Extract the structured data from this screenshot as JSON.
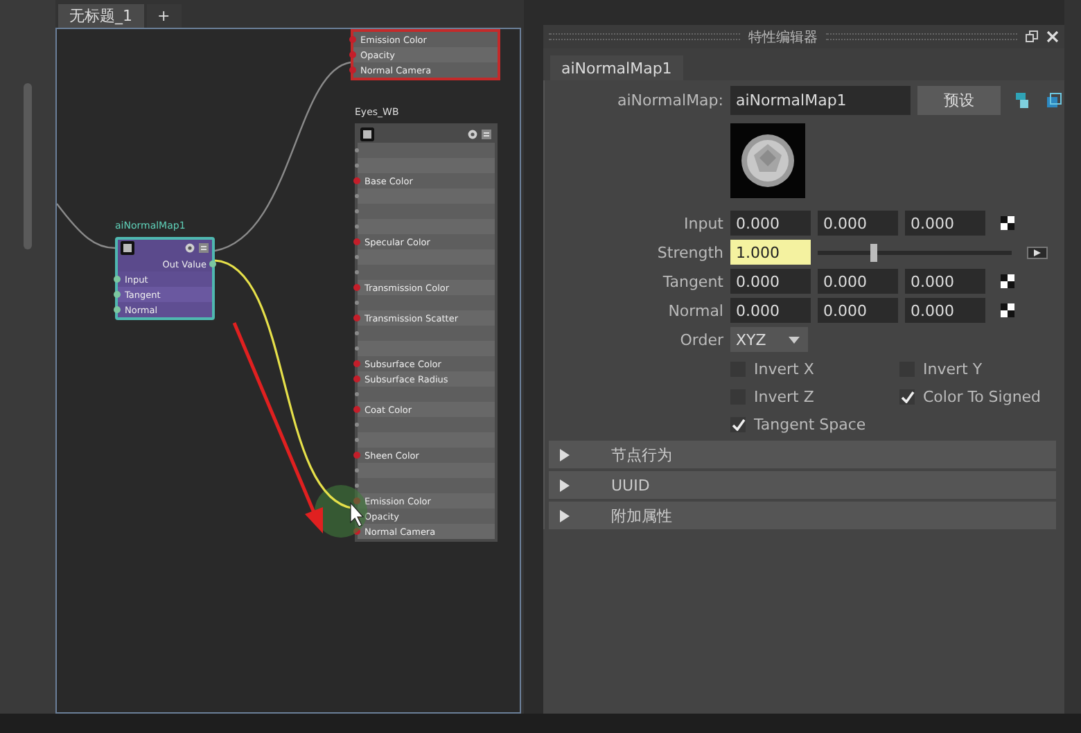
{
  "document_tabs": [
    {
      "label": "无标题_1",
      "selected": true
    },
    {
      "label": "+",
      "selected": false
    }
  ],
  "node_editor": {
    "nodes": [
      {
        "kind": "cut",
        "color": "#c42a2a",
        "rows": [
          {
            "label": "Emission Color"
          },
          {
            "label": "Opacity"
          },
          {
            "label": "Normal Camera"
          }
        ]
      },
      {
        "kind": "shader",
        "title": "Eyes_WB",
        "color": "#4a4a4a",
        "rows": [
          {},
          {},
          {
            "label": "Base Color"
          },
          {},
          {},
          {},
          {
            "label": "Specular Color"
          },
          {},
          {},
          {
            "label": "Transmission Color"
          },
          {},
          {
            "label": "Transmission Scatter"
          },
          {},
          {},
          {
            "label": "Subsurface Color"
          },
          {
            "label": "Subsurface Radius"
          },
          {},
          {
            "label": "Coat Color"
          },
          {},
          {},
          {
            "label": "Sheen Color"
          },
          {},
          {},
          {
            "label": "Emission Color"
          },
          {
            "label": "Opacity"
          },
          {
            "label": "Normal Camera"
          }
        ]
      },
      {
        "kind": "utility",
        "title": "aiNormalMap1",
        "color": "#4fb8b0",
        "output": "Out Value",
        "rows": [
          {
            "label": "Input"
          },
          {
            "label": "Tangent"
          },
          {
            "label": "Normal"
          }
        ]
      }
    ]
  },
  "attribute_editor": {
    "title": "特性编辑器",
    "tab": {
      "label": "aiNormalMap1",
      "selected": true
    },
    "node_type_label": "aiNormalMap:",
    "node_name": "aiNormalMap1",
    "preset_button": "预设",
    "attributes": [
      {
        "kind": "vector",
        "label": "Input",
        "values": [
          "0.000",
          "0.000",
          "0.000"
        ]
      },
      {
        "kind": "slider",
        "label": "Strength",
        "value": "1.000",
        "level": 0.27
      },
      {
        "kind": "vector",
        "label": "Tangent",
        "values": [
          "0.000",
          "0.000",
          "0.000"
        ]
      },
      {
        "kind": "vector",
        "label": "Normal",
        "values": [
          "0.000",
          "0.000",
          "0.000"
        ]
      },
      {
        "kind": "dropdown",
        "label": "Order",
        "value": "XYZ"
      }
    ],
    "checkboxes": [
      {
        "label": "Invert X",
        "checked": false
      },
      {
        "label": "Invert Y",
        "checked": false
      },
      {
        "label": "Invert Z",
        "checked": false
      },
      {
        "label": "Color To Signed",
        "checked": true
      },
      {
        "label": "Tangent Space",
        "checked": true
      }
    ],
    "sections": [
      {
        "label": "节点行为",
        "expanded": false
      },
      {
        "label": "UUID",
        "expanded": false
      },
      {
        "label": "附加属性",
        "expanded": false
      }
    ]
  }
}
